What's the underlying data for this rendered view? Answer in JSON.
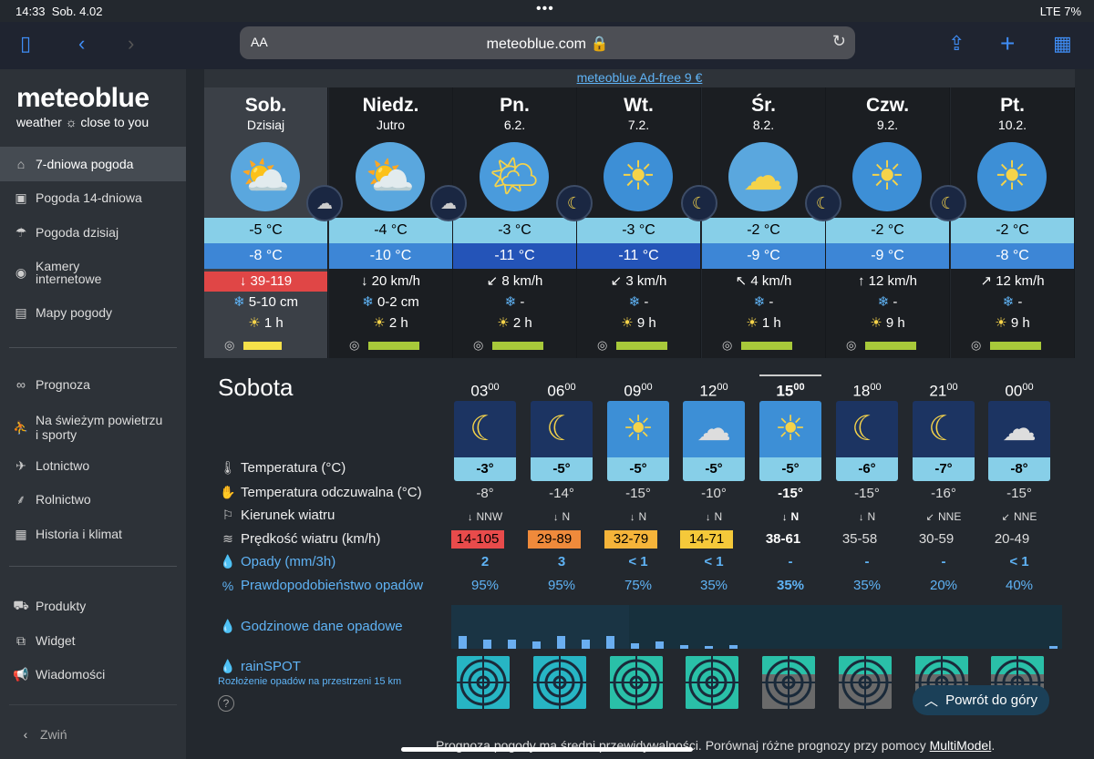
{
  "status": {
    "time": "14:33",
    "date": "Sob. 4.02",
    "signal": "LTE 7%"
  },
  "browser": {
    "aa": "AA",
    "url": "meteoblue.com"
  },
  "logo": {
    "title": "meteoblue",
    "subtitle": "weather ☼ close to you"
  },
  "sidebar": {
    "items": [
      {
        "label": "7-dniowa pogoda",
        "icon": "home-icon"
      },
      {
        "label": "Pogoda 14-dniowa",
        "icon": "calendar-icon"
      },
      {
        "label": "Pogoda dzisiaj",
        "icon": "weather-icon"
      },
      {
        "label": "Kamery internetowe",
        "icon": "webcam-icon"
      },
      {
        "label": "Mapy pogody",
        "icon": "map-icon"
      },
      {
        "label": "Prognoza",
        "icon": "binoculars-icon"
      },
      {
        "label": "Na świeżym powietrzu i sporty",
        "icon": "hiker-icon"
      },
      {
        "label": "Lotnictwo",
        "icon": "plane-icon"
      },
      {
        "label": "Rolnictwo",
        "icon": "wheat-icon"
      },
      {
        "label": "Historia i klimat",
        "icon": "table-icon"
      },
      {
        "label": "Produkty",
        "icon": "cart-icon"
      },
      {
        "label": "Widget",
        "icon": "widget-icon"
      },
      {
        "label": "Wiadomości",
        "icon": "megaphone-icon"
      }
    ],
    "collapse": "Zwiń"
  },
  "ad_free": "meteoblue Ad-free 9 €",
  "days": [
    {
      "name": "Sob.",
      "date": "Dzisiaj",
      "tmax": "-5 °C",
      "tmin": "-8 °C",
      "wind": "39-119",
      "wind_arrow": "↓",
      "snow": "5-10 cm",
      "sun": "1 h",
      "icon": "cloudy-snow"
    },
    {
      "name": "Niedz.",
      "date": "Jutro",
      "tmax": "-4 °C",
      "tmin": "-10 °C",
      "wind": "20 km/h",
      "wind_arrow": "↓",
      "snow": "0-2 cm",
      "sun": "2 h",
      "icon": "partly-cloudy"
    },
    {
      "name": "Pn.",
      "date": "6.2.",
      "tmax": "-3 °C",
      "tmin": "-11 °C",
      "wind": "8 km/h",
      "wind_arrow": "↙",
      "snow": "-",
      "sun": "2 h",
      "icon": "sun-cloud"
    },
    {
      "name": "Wt.",
      "date": "7.2.",
      "tmax": "-3 °C",
      "tmin": "-11 °C",
      "wind": "3 km/h",
      "wind_arrow": "↙",
      "snow": "-",
      "sun": "9 h",
      "icon": "sunny"
    },
    {
      "name": "Śr.",
      "date": "8.2.",
      "tmax": "-2 °C",
      "tmin": "-9 °C",
      "wind": "4 km/h",
      "wind_arrow": "↖",
      "snow": "-",
      "sun": "1 h",
      "icon": "fog"
    },
    {
      "name": "Czw.",
      "date": "9.2.",
      "tmax": "-2 °C",
      "tmin": "-9 °C",
      "wind": "12 km/h",
      "wind_arrow": "↑",
      "snow": "-",
      "sun": "9 h",
      "icon": "sunny"
    },
    {
      "name": "Pt.",
      "date": "10.2.",
      "tmax": "-2 °C",
      "tmin": "-8 °C",
      "wind": "12 km/h",
      "wind_arrow": "↗",
      "snow": "-",
      "sun": "9 h",
      "icon": "sunny"
    }
  ],
  "today": {
    "title": "Sobota",
    "hours": [
      {
        "h": "03",
        "temp": "-3°",
        "feels": "-8°",
        "dir": "NNW",
        "speed": "14-105",
        "speed_color": "#e84b4b",
        "precip": "2",
        "prob": "95%"
      },
      {
        "h": "06",
        "temp": "-5°",
        "feels": "-14°",
        "dir": "N",
        "speed": "29-89",
        "speed_color": "#ef8a3b",
        "precip": "3",
        "prob": "95%"
      },
      {
        "h": "09",
        "temp": "-5°",
        "feels": "-15°",
        "dir": "N",
        "speed": "32-79",
        "speed_color": "#f5b43a",
        "precip": "< 1",
        "prob": "75%"
      },
      {
        "h": "12",
        "temp": "-5°",
        "feels": "-10°",
        "dir": "N",
        "speed": "14-71",
        "speed_color": "#f5c93a",
        "precip": "< 1",
        "prob": "35%"
      },
      {
        "h": "15",
        "temp": "-5°",
        "feels": "-15°",
        "dir": "N",
        "speed": "38-61",
        "speed_color": "",
        "precip": "-",
        "prob": "35%"
      },
      {
        "h": "18",
        "temp": "-6°",
        "feels": "-15°",
        "dir": "N",
        "speed": "35-58",
        "speed_color": "",
        "precip": "-",
        "prob": "35%"
      },
      {
        "h": "21",
        "temp": "-7°",
        "feels": "-16°",
        "dir": "NNE",
        "speed": "30-59",
        "speed_color": "",
        "precip": "-",
        "prob": "20%"
      },
      {
        "h": "00",
        "temp": "-8°",
        "feels": "-15°",
        "dir": "NNE",
        "speed": "20-49",
        "speed_color": "",
        "precip": "< 1",
        "prob": "40%"
      }
    ],
    "labels": {
      "temp": "Temperatura (°C)",
      "feels": "Temperatura odczuwalna (°C)",
      "dir": "Kierunek wiatru",
      "speed": "Prędkość wiatru (km/h)",
      "precip": "Opady (mm/3h)",
      "prob": "Prawdopodobieństwo opadów",
      "hourly": "Godzinowe dane opadowe",
      "rainspot": "rainSPOT",
      "rainspot_sub": "Rozłożenie opadów na przestrzeni 15 km",
      "help": "?"
    }
  },
  "back_to_top": "Powrót do góry",
  "footer": {
    "text": "Prognoza pogody ma średni przewidywalności. Porównaj różne prognozy przy pomocy ",
    "link": "MultiModel",
    "end": "."
  },
  "colors": {
    "accent": "#5fb3f5",
    "tmax": "#87cfe8",
    "tmin": "#3d86d6",
    "tmin_cold": "#2454b8",
    "danger": "#e84b4b"
  }
}
